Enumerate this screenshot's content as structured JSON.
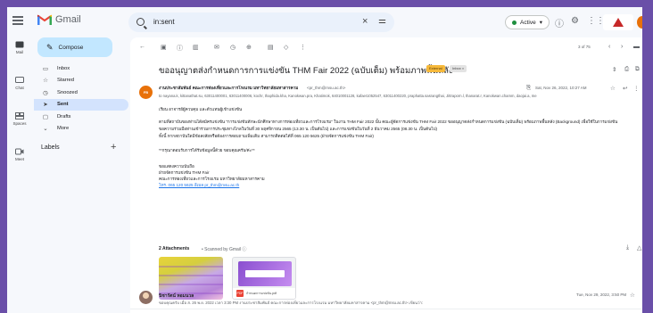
{
  "app": {
    "name": "Gmail",
    "search_value": "in:sent",
    "status": "Active"
  },
  "rail": [
    {
      "label": "Mail",
      "icon": "mail-icon"
    },
    {
      "label": "Chat",
      "icon": "chat-icon"
    },
    {
      "label": "Spaces",
      "icon": "spaces-icon"
    },
    {
      "label": "Meet",
      "icon": "meet-icon"
    }
  ],
  "sidebar": {
    "compose_label": "Compose",
    "items": [
      {
        "label": "Inbox",
        "icon": "▭"
      },
      {
        "label": "Starred",
        "icon": "☆"
      },
      {
        "label": "Snoozed",
        "icon": "◷"
      },
      {
        "label": "Sent",
        "icon": "➤",
        "active": true
      },
      {
        "label": "Drafts",
        "icon": "▢"
      },
      {
        "label": "More",
        "icon": "⌄"
      }
    ],
    "labels_heading": "Labels"
  },
  "toolbar": {
    "pages": "3 of 75"
  },
  "message": {
    "subject": "ขออนุญาตส่งกำหนดการการแข่งขัน THM Fair 2022 (ฉบับเต็ม) พร้อมภาพพื้นหลัง",
    "tag_primary": "External",
    "tag_secondary": "Inbox ×",
    "sender_avatar_text": "FB",
    "sender_name": "งานประชาสัมพันธ์ คณะการท่องเที่ยวและการโรงแรม มหาวิทยาลัยมหาสารคาม",
    "sender_email": "<pr_thm@msu.ac.th>",
    "date": "Sat, Nov 26, 2022, 10:27 AM",
    "recipients": "to nayana.k, kittanathat.su, 63011400001, 63011400006, kochr, thaphida.kha, Kanokwan.pra, Khatimok, 64010001128, kafaeI1052547, 63011400220, praphatta.sasrangthai, Jittraporn.l, thanarat.r, Kanokwan.chamm, daojai.a, me"
  },
  "body_lines": [
    "เรียน อาจารย์ผู้ควบคุม และตัวแทนผู้เข้าแข่งขัน",
    "ตามที่สถาบันของท่านได้สมัครแข่งขัน \"การแข่งขันทักษะนักศึกษาทางการท่องเที่ยวและการโรงแรม\" ในงาน THM Fair 2022 นั้น คณะผู้จัดการแข่งขัน THM Fair 2022 ขออนุญาตส่งกำหนดการแข่งขัน (ฉบับเต็ม) พร้อมภาพพื้นหลัง (Background) เพื่อใช้ในการแข่งขัน",
    "ขอความร่วมมือท่านเข้าร่วมการประชุมทางไกลในวันที่ 30 พฤศจิกายน 2565 (13.30 น. เป็นต้นไป) และการแข่งขันในวันที่ 2 ธันวาคม 2565 (08.30 น. เป็นต้นไป)",
    "ทั้งนี้ หากสถาบันใดมีข้อสงสัยหรือต้องการสอบถามเพิ่มเติม สามารถติดต่อได้ที่ 065 120 5625 (ฝ่ายจัดการแข่งขัน THM Fair)",
    "**กรุณาตอบรับการได้รับข้อมูลนี้ด้วย ขอบคุณครับ/ค่ะ**",
    "ขอแสดงความนับถือ",
    "ฝ่ายจัดการแข่งขัน THM Fair",
    "คณะการท่องเที่ยวและการโรงแรม มหาวิทยาลัยมหาสารคาม",
    "โทร. 065 120 5625 อีเมล pr_thm@msu.ac.th"
  ],
  "attachments": {
    "label": "2 Attachments",
    "scan_note": "• Scanned by Gmail ⓘ",
    "file2_name": "กำหนดการแข่งขัน.pdf"
  },
  "reply": {
    "name": "นิชารัตน์ หอมนวล",
    "snippet": "ขอบคุณครับ เมื่อ ส. 26 พ.ย. 2022 เวลา 3:30 PM งานประชาสัมพันธ์ คณะการท่องเที่ยวและการโรงแรม มหาวิทยาลัยมหาสารคาม <pr_thm@msu.ac.th> เขียนว่า:",
    "date": "Tue, Nov 29, 2022, 3:50 PM"
  }
}
